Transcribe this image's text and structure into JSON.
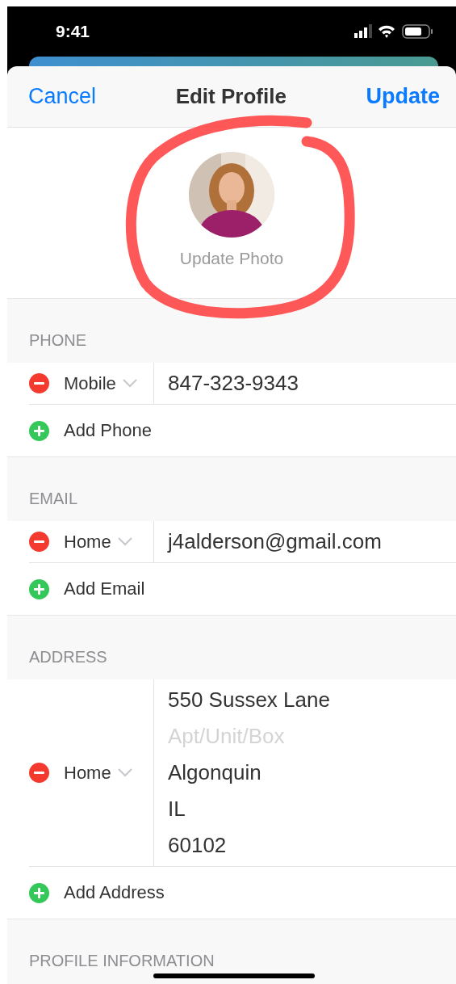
{
  "status_bar": {
    "time": "9:41"
  },
  "nav": {
    "cancel": "Cancel",
    "title": "Edit Profile",
    "update": "Update"
  },
  "photo": {
    "kind": "picture",
    "caption": "Update Photo"
  },
  "sections": [
    {
      "header": "PHONE",
      "entries": [
        {
          "label": "Mobile",
          "lines": [
            {
              "kind": "value",
              "text": "847-323-9343"
            }
          ]
        }
      ],
      "add": "Add Phone"
    },
    {
      "header": "EMAIL",
      "entries": [
        {
          "label": "Home",
          "lines": [
            {
              "kind": "value",
              "text": "j4alderson@gmail.com"
            }
          ]
        }
      ],
      "add": "Add Email"
    },
    {
      "header": "ADDRESS",
      "entries": [
        {
          "label": "Home",
          "lines": [
            {
              "kind": "value",
              "text": "550 Sussex Lane"
            },
            {
              "kind": "placeholder",
              "text": "Apt/Unit/Box"
            },
            {
              "kind": "value",
              "text": "Algonquin"
            },
            {
              "kind": "value",
              "text": "IL"
            },
            {
              "kind": "value",
              "text": "60102"
            }
          ]
        }
      ],
      "add": "Add Address"
    },
    {
      "header": "PROFILE INFORMATION"
    }
  ]
}
